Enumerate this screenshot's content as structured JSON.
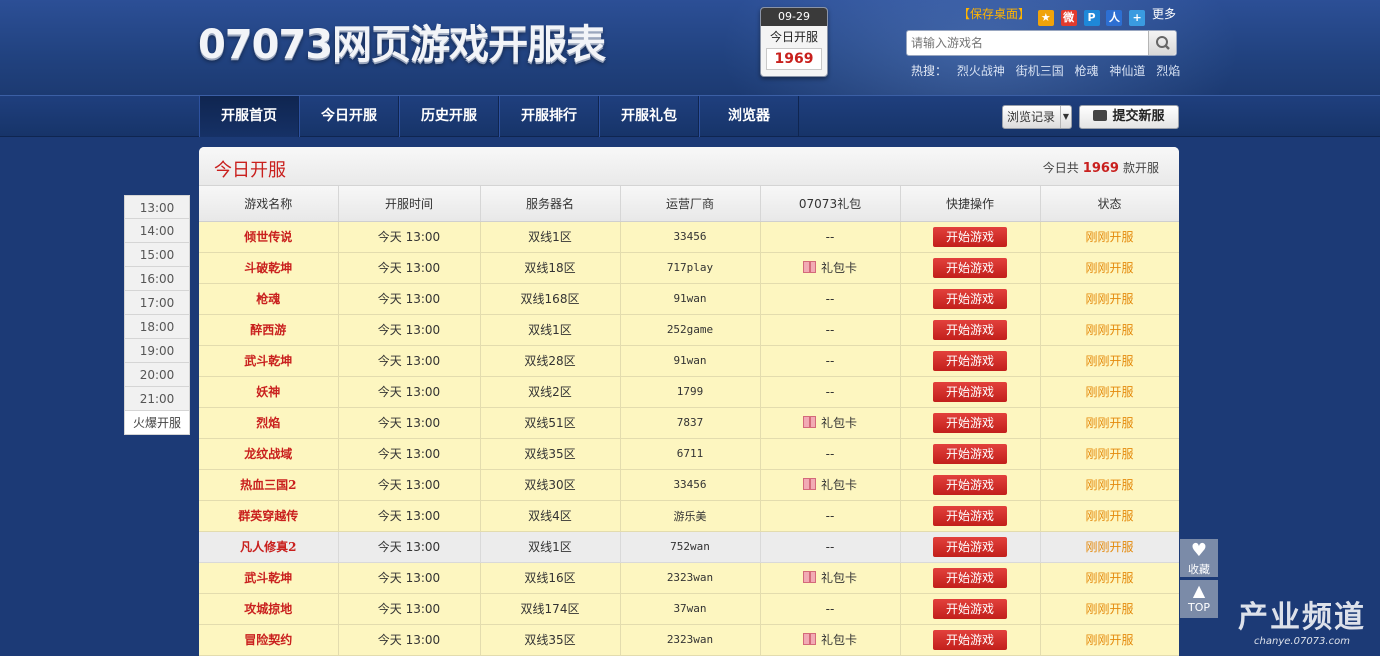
{
  "header": {
    "logo_text": "07073网页游戏开服表",
    "calendar": {
      "date": "09-29",
      "label": "今日开服",
      "count": "1969"
    },
    "save_desktop": "【保存桌面】",
    "more": "更多",
    "search": {
      "placeholder": "请输入游戏名"
    },
    "hot_label": "热搜：",
    "hot_items": [
      "烈火战神",
      "街机三国",
      "枪魂",
      "神仙道",
      "烈焰"
    ]
  },
  "nav": {
    "items": [
      "开服首页",
      "今日开服",
      "历史开服",
      "开服排行",
      "开服礼包",
      "浏览器"
    ],
    "browse_history": "浏览记录",
    "submit_new": "提交新服"
  },
  "timenav": [
    "13:00",
    "14:00",
    "15:00",
    "16:00",
    "17:00",
    "18:00",
    "19:00",
    "20:00",
    "21:00",
    "火爆开服"
  ],
  "panel": {
    "title": "今日开服",
    "summary_prefix": "今日共",
    "summary_count": "1969",
    "summary_suffix": "款开服"
  },
  "table": {
    "columns": [
      "游戏名称",
      "开服时间",
      "服务器名",
      "运营厂商",
      "07073礼包",
      "快捷操作",
      "状态"
    ],
    "rows": [
      {
        "name": "倾世传说",
        "time": "今天 13:00",
        "server": "双线1区",
        "vendor": "33456",
        "gift": "--",
        "action": "开始游戏",
        "status": "刚刚开服"
      },
      {
        "name": "斗破乾坤",
        "time": "今天 13:00",
        "server": "双线18区",
        "vendor": "717play",
        "gift": "礼包卡",
        "action": "开始游戏",
        "status": "刚刚开服"
      },
      {
        "name": "枪魂",
        "time": "今天 13:00",
        "server": "双线168区",
        "vendor": "91wan",
        "gift": "--",
        "action": "开始游戏",
        "status": "刚刚开服"
      },
      {
        "name": "醉西游",
        "time": "今天 13:00",
        "server": "双线1区",
        "vendor": "252game",
        "gift": "--",
        "action": "开始游戏",
        "status": "刚刚开服"
      },
      {
        "name": "武斗乾坤",
        "time": "今天 13:00",
        "server": "双线28区",
        "vendor": "91wan",
        "gift": "--",
        "action": "开始游戏",
        "status": "刚刚开服"
      },
      {
        "name": "妖神",
        "time": "今天 13:00",
        "server": "双线2区",
        "vendor": "1799",
        "gift": "--",
        "action": "开始游戏",
        "status": "刚刚开服"
      },
      {
        "name": "烈焰",
        "time": "今天 13:00",
        "server": "双线51区",
        "vendor": "7837",
        "gift": "礼包卡",
        "action": "开始游戏",
        "status": "刚刚开服"
      },
      {
        "name": "龙纹战域",
        "time": "今天 13:00",
        "server": "双线35区",
        "vendor": "6711",
        "gift": "--",
        "action": "开始游戏",
        "status": "刚刚开服"
      },
      {
        "name": "热血三国2",
        "time": "今天 13:00",
        "server": "双线30区",
        "vendor": "33456",
        "gift": "礼包卡",
        "action": "开始游戏",
        "status": "刚刚开服"
      },
      {
        "name": "群英穿越传",
        "time": "今天 13:00",
        "server": "双线4区",
        "vendor": "游乐美",
        "gift": "--",
        "action": "开始游戏",
        "status": "刚刚开服"
      },
      {
        "name": "凡人修真2",
        "time": "今天 13:00",
        "server": "双线1区",
        "vendor": "752wan",
        "gift": "--",
        "action": "开始游戏",
        "status": "刚刚开服"
      },
      {
        "name": "武斗乾坤",
        "time": "今天 13:00",
        "server": "双线16区",
        "vendor": "2323wan",
        "gift": "礼包卡",
        "action": "开始游戏",
        "status": "刚刚开服"
      },
      {
        "name": "攻城掠地",
        "time": "今天 13:00",
        "server": "双线174区",
        "vendor": "37wan",
        "gift": "--",
        "action": "开始游戏",
        "status": "刚刚开服"
      },
      {
        "name": "冒险契约",
        "time": "今天 13:00",
        "server": "双线35区",
        "vendor": "2323wan",
        "gift": "礼包卡",
        "action": "开始游戏",
        "status": "刚刚开服"
      }
    ]
  },
  "float": {
    "favorite": "收藏",
    "top": "TOP"
  },
  "watermark": {
    "title": "产业频道",
    "url": "chanye.07073.com"
  },
  "colors": {
    "accent_red": "#c9201e",
    "status_orange": "#e48a0c",
    "row_yellow": "#fdf6c0"
  }
}
